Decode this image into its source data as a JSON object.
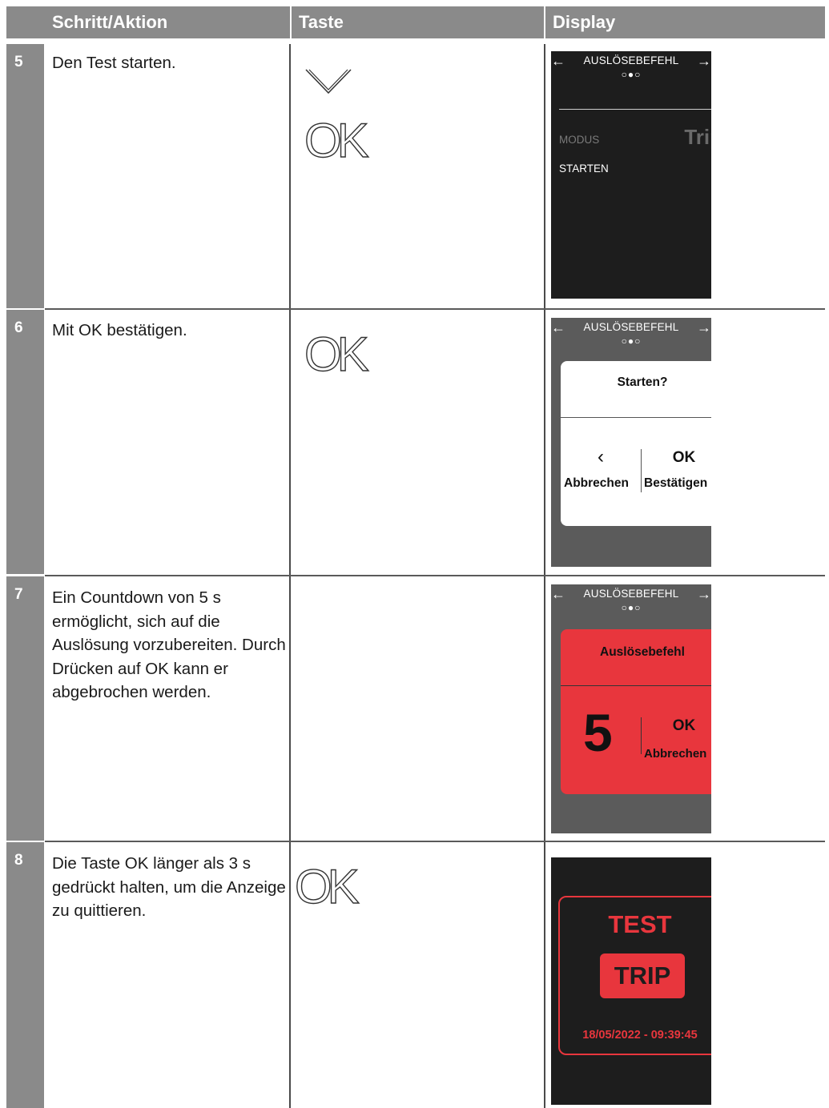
{
  "header": {
    "col1": "Schritt/Aktion",
    "col2": "Taste",
    "col3": "Display"
  },
  "rows": [
    {
      "num": "5",
      "text": "Den Test starten.",
      "keys": [
        "chevron-down",
        "OK"
      ],
      "display": {
        "title": "AUSLÖSEBEFEHL",
        "dots": "○●○",
        "modus_label": "MODUS",
        "modus_value": "Trip",
        "start_label": "STARTEN"
      }
    },
    {
      "num": "6",
      "text": "Mit OK bestätigen.",
      "keys": [
        "OK"
      ],
      "display": {
        "title": "AUSLÖSEBEFEHL",
        "dots": "○●○",
        "dialog_title": "Starten?",
        "back_icon": "‹",
        "back_label": "Abbrechen",
        "ok_icon": "OK",
        "ok_label": "Bestätigen"
      }
    },
    {
      "num": "7",
      "text": "Ein Countdown von 5 s ermöglicht, sich auf die Auslösung vorzubereiten. Durch Drücken auf OK kann er abgebrochen werden.",
      "keys": [],
      "display": {
        "title": "AUSLÖSEBEFEHL",
        "dots": "○●○",
        "dialog_title": "Auslösebefehl",
        "countdown": "5",
        "ok_icon": "OK",
        "ok_label": "Abbrechen",
        "accent": "#e8363d"
      }
    },
    {
      "num": "8",
      "text": "Die Taste OK länger als 3 s gedrückt halten, um die Anzeige zu quittieren.",
      "keys": [
        "OK"
      ],
      "display": {
        "line1": "TEST",
        "line2": "TRIP",
        "timestamp": "18/05/2022 - 09:39:45",
        "accent": "#e8363d"
      }
    }
  ],
  "key_ok_label": "OK"
}
